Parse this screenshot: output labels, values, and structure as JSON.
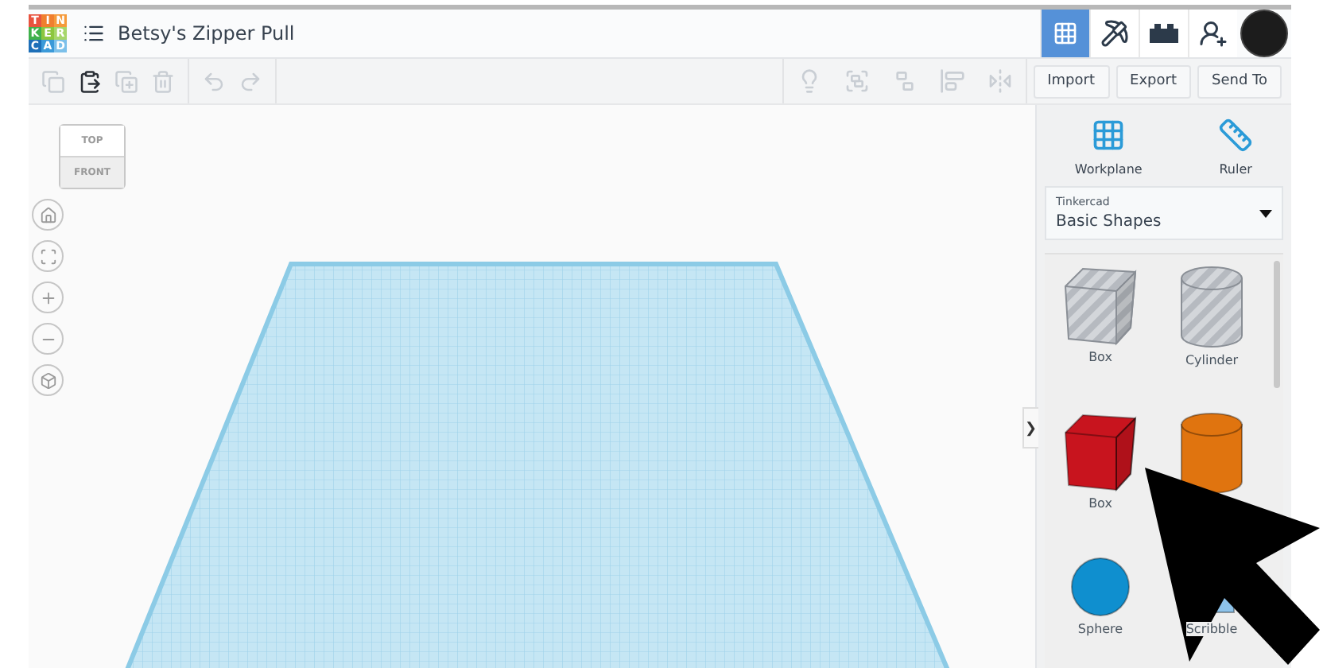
{
  "logo": {
    "letters": [
      {
        "char": "T",
        "color": "#e8533f"
      },
      {
        "char": "I",
        "color": "#f07f2e"
      },
      {
        "char": "N",
        "color": "#f59a3b"
      },
      {
        "char": "K",
        "color": "#3fb14b"
      },
      {
        "char": "E",
        "color": "#8cc63f"
      },
      {
        "char": "R",
        "color": "#a6d66a"
      },
      {
        "char": "C",
        "color": "#1d6fb8"
      },
      {
        "char": "A",
        "color": "#3b9ad9"
      },
      {
        "char": "D",
        "color": "#7cc0ea"
      }
    ]
  },
  "document": {
    "title": "Betsy's Zipper Pull"
  },
  "views": [
    {
      "kind": "grid",
      "selected": true
    },
    {
      "kind": "pickaxe",
      "selected": false
    },
    {
      "kind": "bricks",
      "selected": false
    },
    {
      "kind": "add-user",
      "selected": false
    }
  ],
  "edit_tools": [
    {
      "kind": "copy",
      "disabled": true
    },
    {
      "kind": "paste",
      "disabled": false
    },
    {
      "kind": "duplicate",
      "disabled": true
    },
    {
      "kind": "delete",
      "disabled": true
    }
  ],
  "history_tools": [
    {
      "kind": "undo",
      "disabled": true
    },
    {
      "kind": "redo",
      "disabled": true
    }
  ],
  "shape_tools": [
    {
      "kind": "notes",
      "disabled": true
    },
    {
      "kind": "group",
      "disabled": true
    },
    {
      "kind": "ungroup",
      "disabled": true
    },
    {
      "kind": "align",
      "disabled": true
    },
    {
      "kind": "mirror",
      "disabled": true
    }
  ],
  "actions": [
    "Import",
    "Export",
    "Send To"
  ],
  "view_cube": {
    "top": "TOP",
    "front": "FRONT"
  },
  "nav_controls": [
    {
      "kind": "home"
    },
    {
      "kind": "fit"
    },
    {
      "kind": "zoom-in"
    },
    {
      "kind": "zoom-out"
    },
    {
      "kind": "perspective"
    }
  ],
  "panel_tools": [
    {
      "kind": "workplane",
      "label": "Workplane"
    },
    {
      "kind": "ruler",
      "label": "Ruler"
    }
  ],
  "library": {
    "source": "Tinkercad",
    "category": "Basic Shapes"
  },
  "collapse": "❯",
  "shapes": [
    {
      "kind": "box",
      "hole": true,
      "label": "Box"
    },
    {
      "kind": "cylinder",
      "hole": true,
      "label": "Cylinder"
    },
    {
      "kind": "box",
      "hole": false,
      "color": "#c8141e",
      "label": "Box"
    },
    {
      "kind": "cylinder",
      "hole": false,
      "color": "#e0740f"
    },
    {
      "kind": "sphere",
      "hole": false,
      "color": "#0f8fcf",
      "label": "Sphere"
    },
    {
      "kind": "scribble",
      "hole": false,
      "color": "#8ec3ea",
      "label": "Scribble"
    }
  ]
}
